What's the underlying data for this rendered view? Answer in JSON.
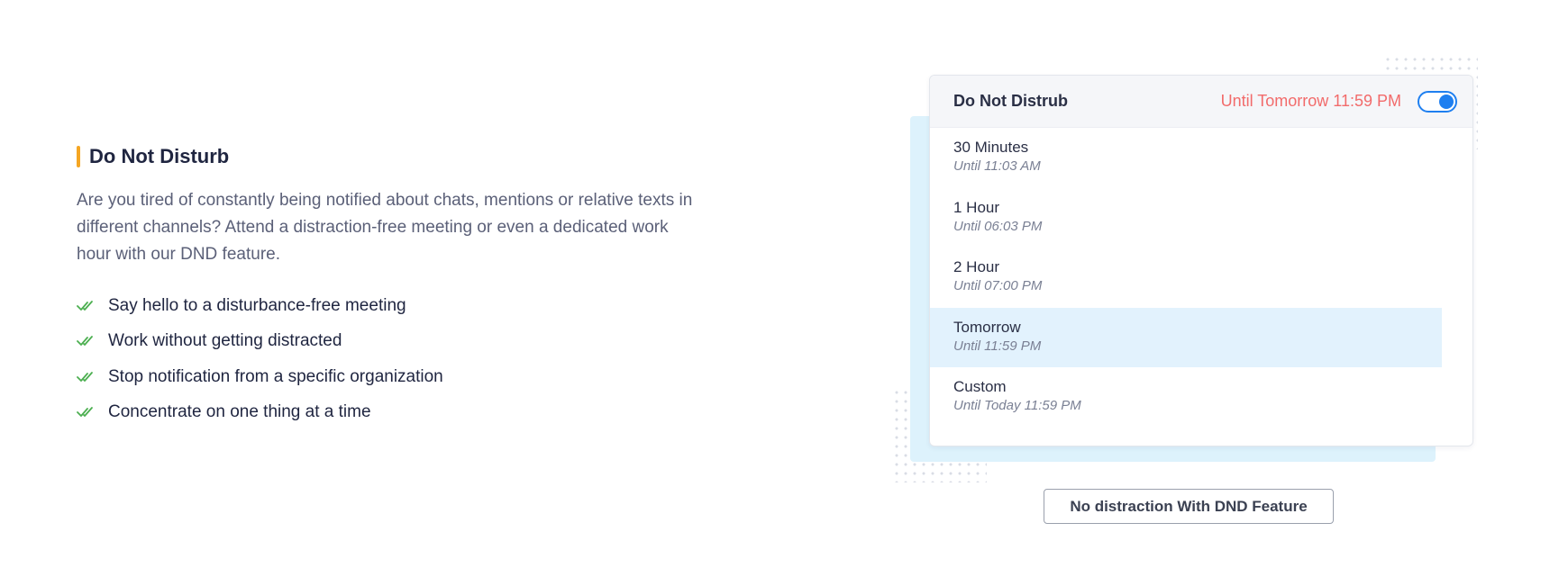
{
  "feature": {
    "title": "Do Not Disturb",
    "description": "Are you tired of constantly being notified about chats, mentions or relative texts in different channels? Attend a distraction-free meeting or even a dedicated work hour with our DND feature.",
    "benefits": [
      "Say hello to a disturbance-free meeting",
      "Work without getting distracted",
      "Stop notification from a specific organization",
      "Concentrate on one thing at a time"
    ],
    "accent_color": "#f5a623",
    "check_color": "#4caf50"
  },
  "dnd_panel": {
    "title": "Do Not Distrub",
    "status": "Until Tomorrow 11:59 PM",
    "status_color": "#f26b6b",
    "toggle_on": true,
    "toggle_color": "#1e7ff0",
    "options": [
      {
        "label": "30 Minutes",
        "sub": "Until 11:03 AM",
        "selected": false
      },
      {
        "label": "1 Hour",
        "sub": "Until 06:03 PM",
        "selected": false
      },
      {
        "label": "2 Hour",
        "sub": "Until 07:00 PM",
        "selected": false
      },
      {
        "label": "Tomorrow",
        "sub": "Until 11:59 PM",
        "selected": true
      },
      {
        "label": "Custom",
        "sub": "Until Today 11:59 PM",
        "selected": false
      }
    ]
  },
  "caption": "No distraction With DND Feature"
}
